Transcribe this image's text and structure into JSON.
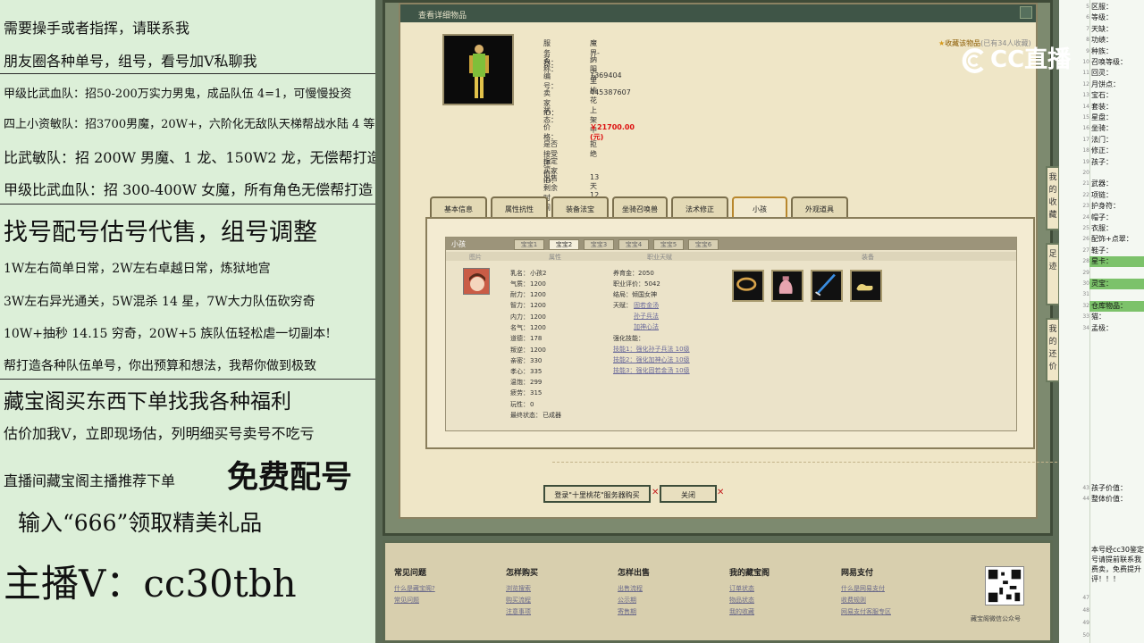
{
  "promo": {
    "lines": [
      "需要操手或者指挥，请联系我",
      "朋友圈各种单号，组号，看号加Ⅴ私聊我",
      "甲级比武血队：招50-200万实力男鬼，成品队伍 4=1，可慢慢投资",
      "四上小资敏队：招3700男魔，20W+，六阶化无敌队天梯帮战水陆 4 等 1",
      "比武敏队：招 200W 男魔、1 龙、150W2 龙，无偿帮打造",
      "甲级比武血队：招 300-400W 女魔，所有角色无偿帮打造",
      "找号配号估号代售，组号调整",
      "1W左右简单日常，2W左右卓越日常，炼狱地宫",
      "3W左右异光通关，5W混杀 14 星，7W大力队伍砍穷奇",
      "10W+抽秒 14.15 穷奇，20W+5 族队伍轻松虐一切副本!",
      "帮打造各种队伍单号，你出预算和想法，我帮你做到极致",
      "藏宝阁买东西下单找我各种福利",
      "估价加我Ⅴ，立即现场估，列明细买号卖号不吃亏",
      "直播间藏宝阁主播推荐下单",
      "免费配号",
      "输入“666”领取精美礼品",
      "主播Ⅴ：cc30tbh"
    ]
  },
  "dialog": {
    "title": "查看详细物品",
    "favorite": "收藏该物品",
    "fav_count": "(已有34人收藏)",
    "info": [
      {
        "k": "服 务 器：",
        "v": "魔界-- 十里桃花"
      },
      {
        "k": "名      称：",
        "v": "纳阳子"
      },
      {
        "k": "编      号：",
        "v": "1369404"
      },
      {
        "k": "卖 家  ID：",
        "v": "445387607"
      },
      {
        "k": "状      态：",
        "v": "上架中"
      },
      {
        "k": "价      格：",
        "v": "￥21700.00 (元)"
      },
      {
        "k": "是否接受还价：",
        "v": "拒绝"
      },
      {
        "k": "指定买家 ID：",
        "v": ""
      },
      {
        "k": "出售剩余时间：",
        "v": "13天12时"
      }
    ],
    "tabs": [
      "基本信息",
      "属性抗性",
      "装备法宝",
      "坐骑召唤兽",
      "法术修正",
      "小孩",
      "外观道具"
    ],
    "active_tab": "小孩",
    "sub_title": "小孩",
    "kid_tabs": [
      "宝宝1",
      "宝宝2",
      "宝宝3",
      "宝宝4",
      "宝宝5",
      "宝宝6"
    ],
    "col_heads": [
      "图片",
      "属性",
      "职业天赋",
      "装备"
    ],
    "kid_stats": [
      {
        "k": "乳名：",
        "v": "小孩2"
      },
      {
        "k": "气质：",
        "v": "1200"
      },
      {
        "k": "耐力：",
        "v": "1200"
      },
      {
        "k": "智力：",
        "v": "1200"
      },
      {
        "k": "内力：",
        "v": "1200"
      },
      {
        "k": "名气：",
        "v": "1200"
      },
      {
        "k": "道德：",
        "v": "178"
      },
      {
        "k": "叛逆：",
        "v": "1200"
      },
      {
        "k": "亲密：",
        "v": "330"
      },
      {
        "k": "孝心：",
        "v": "335"
      },
      {
        "k": "温饱：",
        "v": "299"
      },
      {
        "k": "疲劳：",
        "v": "315"
      },
      {
        "k": "玩性：",
        "v": "0"
      },
      {
        "k": "最终状态：",
        "v": "已成器"
      }
    ],
    "kid_career": {
      "money": "养育金：2050",
      "rating": "职业评价：5042",
      "ending": "结局：倾国女神",
      "talent_label": "天赋：",
      "talents": [
        "固若金汤",
        "孙子兵法",
        "加神心法"
      ],
      "skill_label": "强化技能：",
      "skills": [
        "技能1：强化孙子兵法 10级",
        "技能2：强化加神心法 10级",
        "技能3：强化固若金汤 10级"
      ]
    },
    "buy_button": "登录\"十里桃花\"服务器购买",
    "close_button": "关闭",
    "side_buttons": [
      "我的收藏",
      "足迹",
      "我的还价"
    ]
  },
  "footer": {
    "cols": [
      {
        "h": "常见问题",
        "items": [
          "什么是藏宝阁?",
          "常见问题"
        ]
      },
      {
        "h": "怎样购买",
        "items": [
          "浏览搜索",
          "购买流程",
          "注意事项"
        ]
      },
      {
        "h": "怎样出售",
        "items": [
          "出售流程",
          "公示期",
          "寄售期"
        ]
      },
      {
        "h": "我的藏宝阁",
        "items": [
          "订单状态",
          "物品状态",
          "我的收藏"
        ]
      },
      {
        "h": "网易支付",
        "items": [
          "什么是网易支付",
          "收费规则",
          "网易支付客服专区"
        ]
      }
    ],
    "qr_label": "藏宝阁微信公众号"
  },
  "sheet": {
    "rows": [
      {
        "n": "5",
        "t": "区服："
      },
      {
        "n": "6",
        "t": "等级："
      },
      {
        "n": "7",
        "t": "天缺："
      },
      {
        "n": "8",
        "t": "功绩："
      },
      {
        "n": "9",
        "t": "种族："
      },
      {
        "n": "10",
        "t": "召唤等级："
      },
      {
        "n": "11",
        "t": "回灵："
      },
      {
        "n": "12",
        "t": "月饼点："
      },
      {
        "n": "13",
        "t": "宝石："
      },
      {
        "n": "14",
        "t": "套装："
      },
      {
        "n": "15",
        "t": "星盘："
      },
      {
        "n": "16",
        "t": "坐骑："
      },
      {
        "n": "17",
        "t": "法门："
      },
      {
        "n": "18",
        "t": "修正："
      },
      {
        "n": "19",
        "t": "孩子："
      },
      {
        "n": "20",
        "t": ""
      },
      {
        "n": "21",
        "t": "武器："
      },
      {
        "n": "22",
        "t": "项链："
      },
      {
        "n": "23",
        "t": "护身符："
      },
      {
        "n": "24",
        "t": "帽子："
      },
      {
        "n": "25",
        "t": "衣服："
      },
      {
        "n": "26",
        "t": "配饰+点翠："
      },
      {
        "n": "27",
        "t": "鞋子："
      },
      {
        "n": "28",
        "t": "星卡："
      },
      {
        "n": "29",
        "t": ""
      },
      {
        "n": "30",
        "t": "灵宝："
      },
      {
        "n": "31",
        "t": ""
      },
      {
        "n": "32",
        "t": "仓库物品："
      },
      {
        "n": "33",
        "t": "猫："
      },
      {
        "n": "34",
        "t": "孟极："
      }
    ],
    "bottom": [
      {
        "n": "43",
        "t": "孩子价值："
      },
      {
        "n": "44",
        "t": "整体价值："
      }
    ],
    "note": "本号经cc30鉴定 号请提前联系我 费卖，免费提升 评！！！",
    "tail_rows": [
      "47",
      "48",
      "49",
      "50"
    ]
  },
  "logo": "CC直播"
}
